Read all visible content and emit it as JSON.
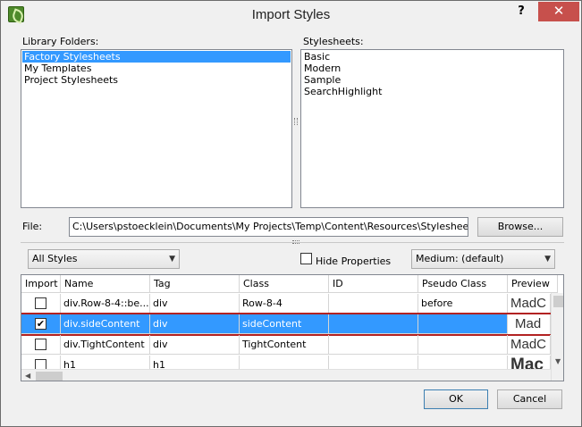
{
  "window": {
    "title": "Import Styles",
    "help": "?",
    "close": "✕"
  },
  "library": {
    "label": "Library Folders:",
    "items": [
      "Factory Stylesheets",
      "My Templates",
      "Project Stylesheets"
    ]
  },
  "stylesheets": {
    "label": "Stylesheets:",
    "items": [
      "Basic",
      "Modern",
      "Sample",
      "SearchHighlight"
    ]
  },
  "file": {
    "label": "File:",
    "value": "C:\\Users\\pstoecklein\\Documents\\My Projects\\Temp\\Content\\Resources\\Stylesheets\\Mai",
    "browse_label": "Browse..."
  },
  "filters": {
    "styles_selected": "All Styles",
    "hide_properties_label": "Hide Properties",
    "medium_selected": "Medium: (default)"
  },
  "grid": {
    "columns": [
      "Import",
      "Name",
      "Tag",
      "Class",
      "ID",
      "Pseudo Class",
      "Preview"
    ],
    "rows": [
      {
        "checked": false,
        "name": "div.Row-8-4::be...",
        "tag": "div",
        "class": "Row-8-4",
        "id": "",
        "pseudo": "before",
        "preview": "MadC"
      },
      {
        "checked": true,
        "name": "div.sideContent",
        "tag": "div",
        "class": "sideContent",
        "id": "",
        "pseudo": "",
        "preview": "Mad"
      },
      {
        "checked": false,
        "name": "div.TightContent",
        "tag": "div",
        "class": "TightContent",
        "id": "",
        "pseudo": "",
        "preview": "MadC"
      },
      {
        "checked": false,
        "name": "h1",
        "tag": "h1",
        "class": "",
        "id": "",
        "pseudo": "",
        "preview": "Mac"
      }
    ]
  },
  "buttons": {
    "ok": "OK",
    "cancel": "Cancel"
  }
}
